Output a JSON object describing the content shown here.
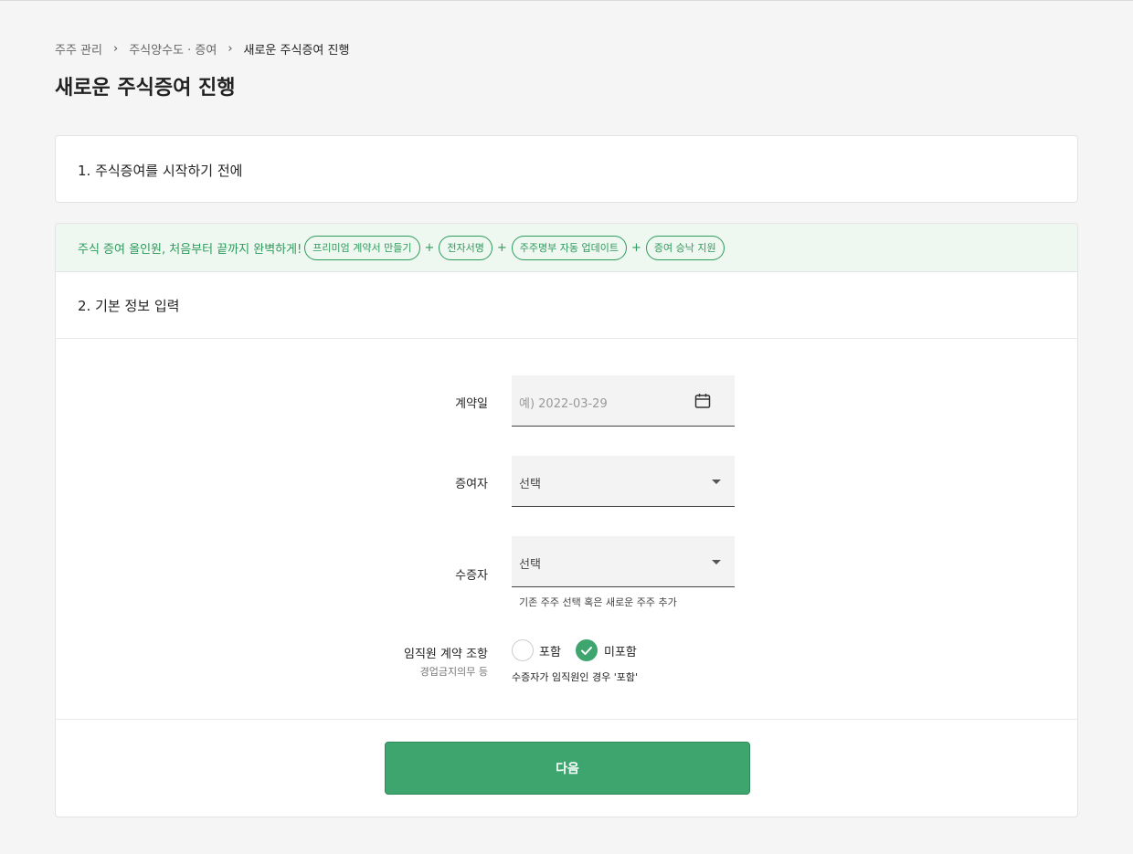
{
  "breadcrumb": {
    "items": [
      "주주 관리",
      "주식양수도 · 증여",
      "새로운 주식증여 진행"
    ],
    "separator": "›"
  },
  "page": {
    "title": "새로운 주식증여 진행"
  },
  "section1": {
    "title": "1. 주식증여를 시작하기 전에"
  },
  "promo": {
    "text": "주식 증여 올인원, 처음부터 끝까지 완벽하게!",
    "pills": [
      "프리미엄 계약서 만들기",
      "전자서명",
      "주주명부 자동 업데이트",
      "증여 승낙 지원"
    ],
    "plus": "+"
  },
  "section2": {
    "title": "2. 기본 정보 입력"
  },
  "form": {
    "contract_date": {
      "label": "계약일",
      "placeholder": "예) 2022-03-29",
      "icon": "calendar-icon"
    },
    "donor": {
      "label": "증여자",
      "value": "선택"
    },
    "recipient": {
      "label": "수증자",
      "value": "선택",
      "helper": "기존 주주 선택 혹은 새로운 주주 추가"
    },
    "employee_terms": {
      "label": "임직원 계약 조항",
      "sublabel": "경업금지의무 등",
      "options": [
        "포함",
        "미포함"
      ],
      "selected": "미포함",
      "helper": "수증자가 임직원인 경우 '포함'"
    }
  },
  "next_button": {
    "label": "다음"
  },
  "colors": {
    "accent": "#3ea56f",
    "promo_bg": "#eef7f0",
    "promo_text": "#2e9a5c"
  }
}
